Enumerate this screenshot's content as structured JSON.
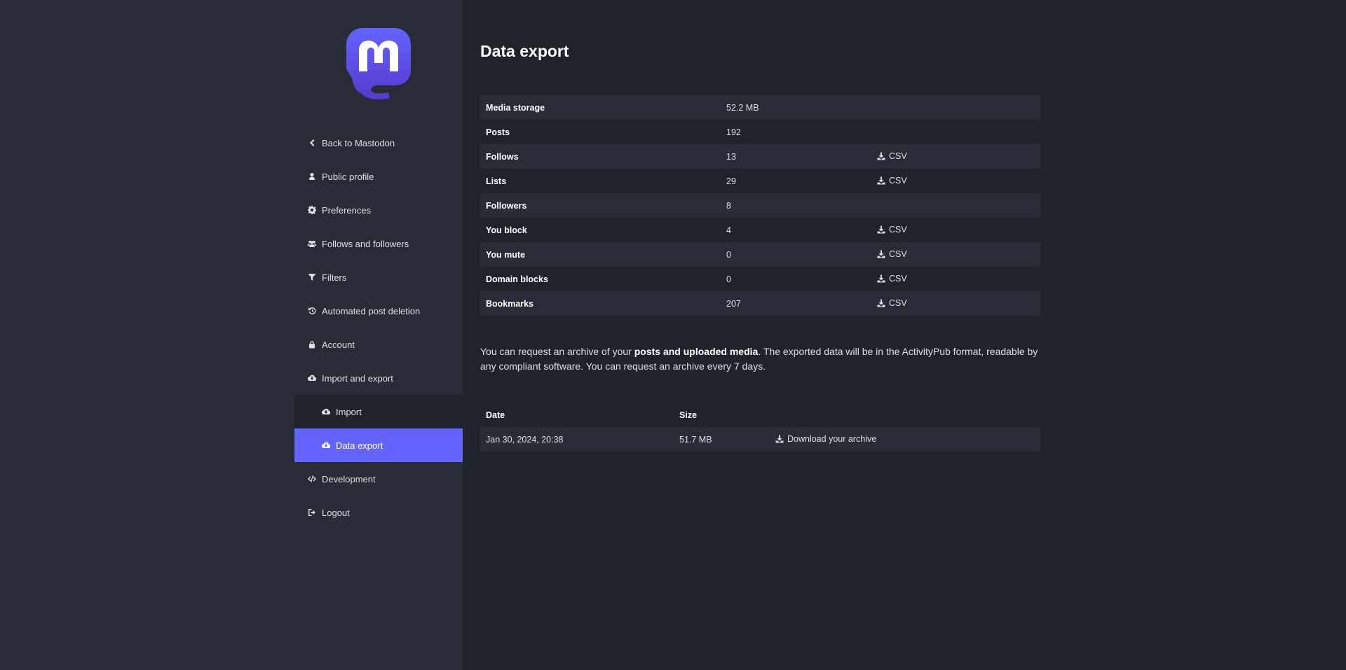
{
  "colors": {
    "accent": "#6364ff",
    "sidebar": "#282c37",
    "background": "#1f232b"
  },
  "sidebar": {
    "logo_icon": "mastodon-logo",
    "items": [
      {
        "label": "Back to Mastodon",
        "icon": "chevron-left-icon"
      },
      {
        "label": "Public profile",
        "icon": "user-icon"
      },
      {
        "label": "Preferences",
        "icon": "gear-icon"
      },
      {
        "label": "Follows and followers",
        "icon": "users-icon"
      },
      {
        "label": "Filters",
        "icon": "filter-icon"
      },
      {
        "label": "Automated post deletion",
        "icon": "history-icon"
      },
      {
        "label": "Account",
        "icon": "lock-icon"
      },
      {
        "label": "Import and export",
        "icon": "cloud-download-icon"
      },
      {
        "label": "Import",
        "icon": "cloud-download-icon"
      },
      {
        "label": "Data export",
        "icon": "cloud-download-icon",
        "active": true
      },
      {
        "label": "Development",
        "icon": "code-icon"
      },
      {
        "label": "Logout",
        "icon": "sign-out-icon"
      }
    ]
  },
  "main": {
    "title": "Data export",
    "stats": [
      {
        "label": "Media storage",
        "value": "52.2 MB",
        "csv": ""
      },
      {
        "label": "Posts",
        "value": "192",
        "csv": ""
      },
      {
        "label": "Follows",
        "value": "13",
        "csv": "CSV"
      },
      {
        "label": "Lists",
        "value": "29",
        "csv": "CSV"
      },
      {
        "label": "Followers",
        "value": "8",
        "csv": ""
      },
      {
        "label": "You block",
        "value": "4",
        "csv": "CSV"
      },
      {
        "label": "You mute",
        "value": "0",
        "csv": "CSV"
      },
      {
        "label": "Domain blocks",
        "value": "0",
        "csv": "CSV"
      },
      {
        "label": "Bookmarks",
        "value": "207",
        "csv": "CSV"
      }
    ],
    "hint": {
      "before": "You can request an archive of your ",
      "bold": "posts and uploaded media",
      "after": ". The exported data will be in the ActivityPub format, readable by any compliant software. You can request an archive every 7 days."
    },
    "archives": {
      "headers": {
        "date": "Date",
        "size": "Size"
      },
      "rows": [
        {
          "date": "Jan 30, 2024, 20:38",
          "size": "51.7 MB",
          "download": "Download your archive"
        }
      ]
    }
  }
}
